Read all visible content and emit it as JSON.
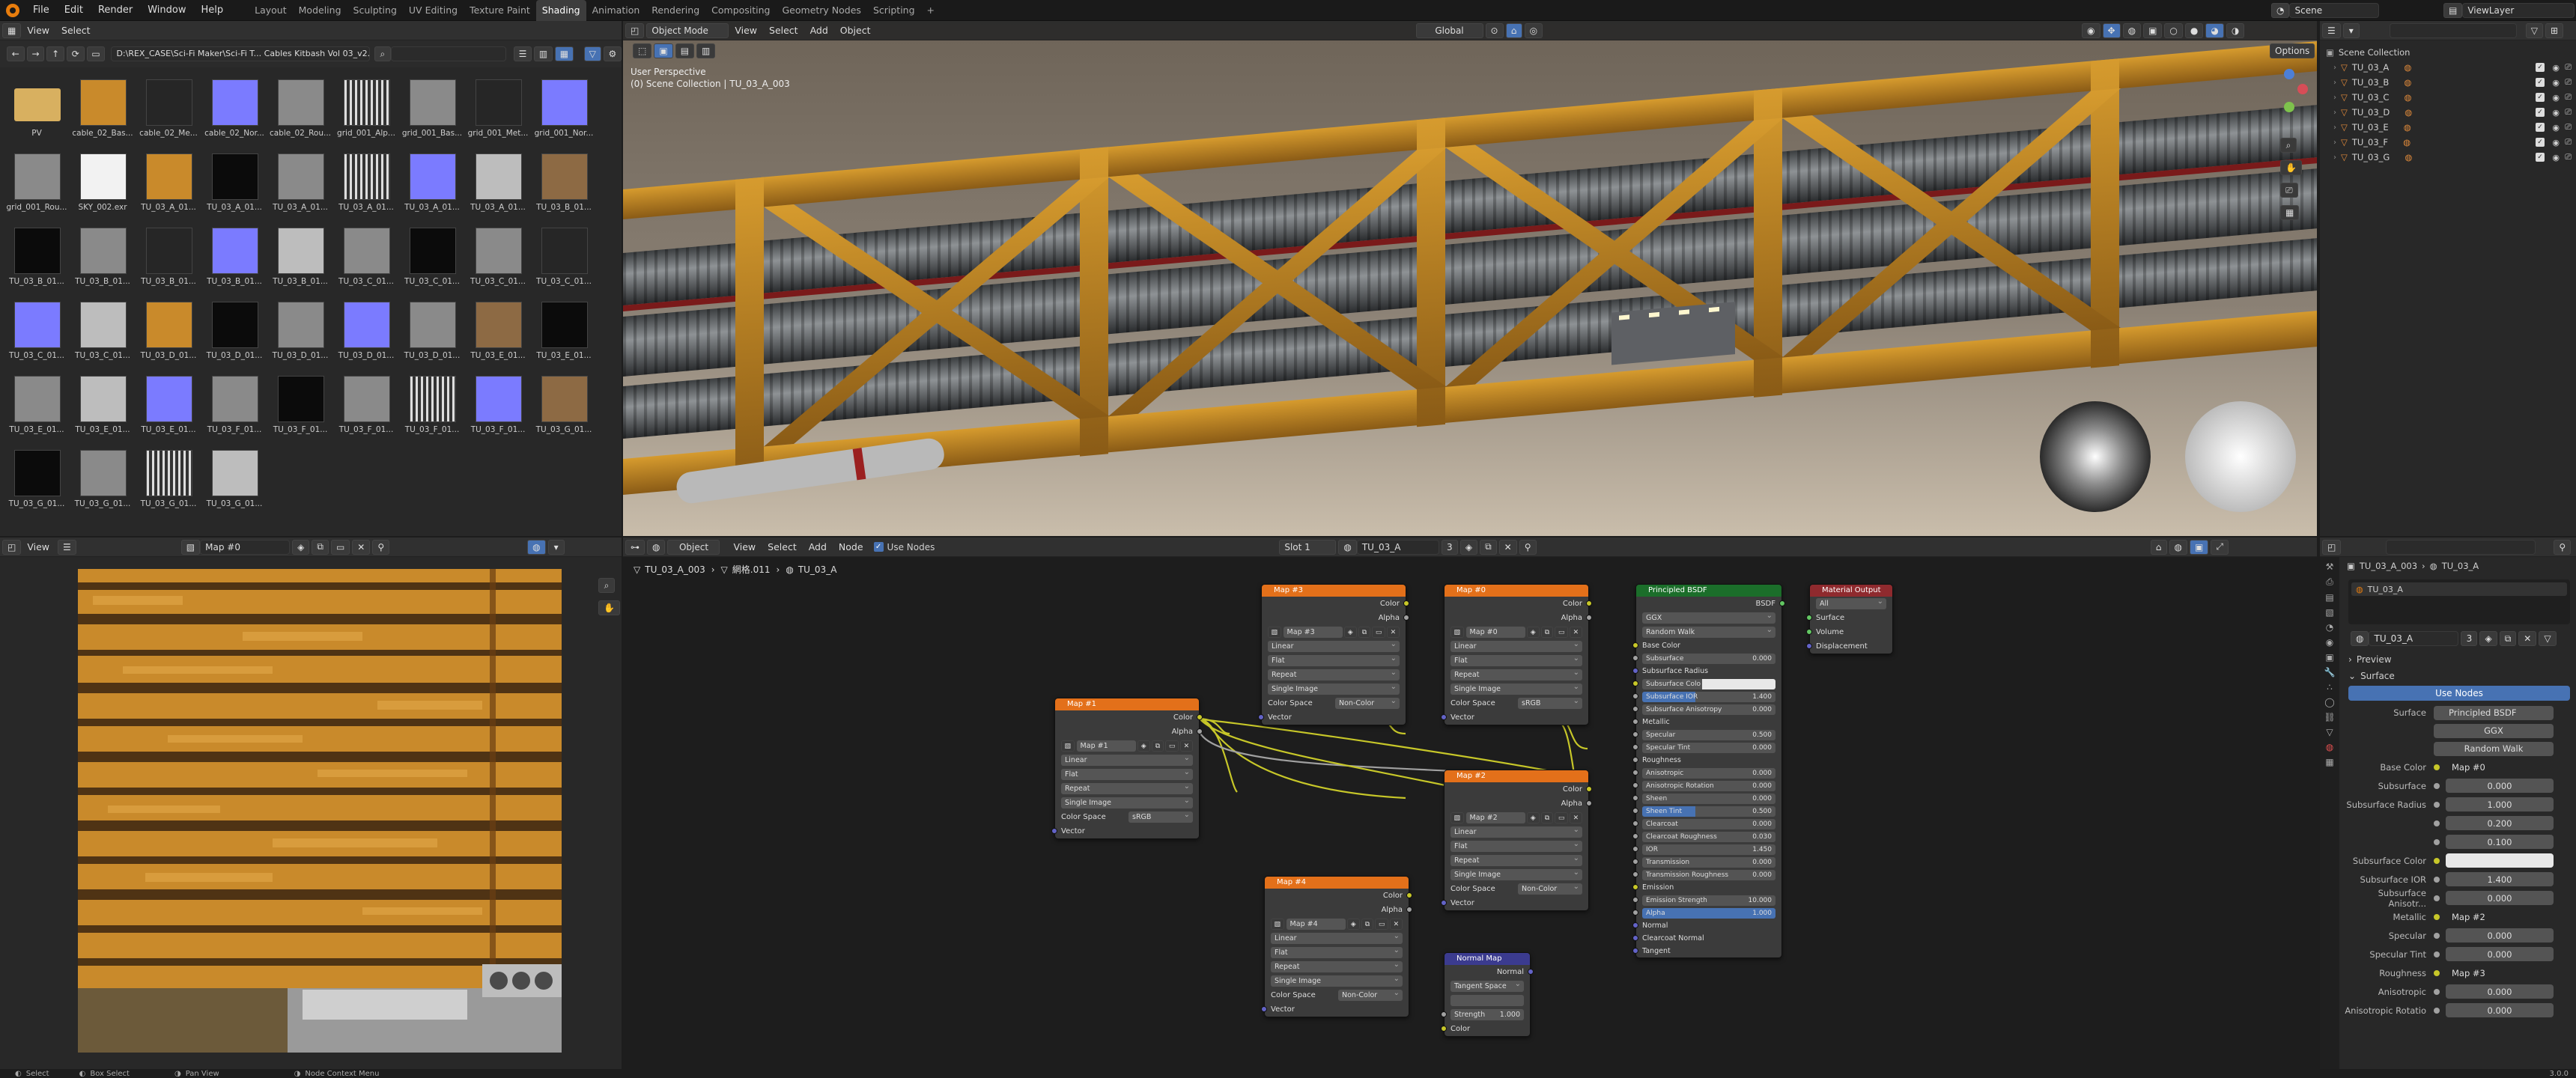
{
  "topbar": {
    "menus": [
      "File",
      "Edit",
      "Render",
      "Window",
      "Help"
    ],
    "workspaces": [
      "Layout",
      "Modeling",
      "Sculpting",
      "UV Editing",
      "Texture Paint",
      "Shading",
      "Animation",
      "Rendering",
      "Compositing",
      "Geometry Nodes",
      "Scripting"
    ],
    "active_workspace": "Shading",
    "add_tab": "+",
    "scene": "Scene",
    "view_layer": "ViewLayer"
  },
  "file_browser": {
    "view_menu": "View",
    "select_menu": "Select",
    "path": "D:\\REX_CASE\\Sci-Fi Maker\\Sci-Fi T... Cables Kitbash Vol 03_v2.0_PBR\\",
    "thumbnails": [
      {
        "label": "PV",
        "kind": "folder"
      },
      {
        "label": "cable_02_Bas...",
        "kind": "rust"
      },
      {
        "label": "cable_02_Me...",
        "kind": "dark"
      },
      {
        "label": "cable_02_Nor...",
        "kind": "normal"
      },
      {
        "label": "cable_02_Rou...",
        "kind": "gray"
      },
      {
        "label": "grid_001_Alp...",
        "kind": "stripes"
      },
      {
        "label": "grid_001_Bas...",
        "kind": "gray"
      },
      {
        "label": "grid_001_Met...",
        "kind": "dark"
      },
      {
        "label": "grid_001_Nor...",
        "kind": "normal"
      },
      {
        "label": "grid_001_Rou...",
        "kind": "gray"
      },
      {
        "label": "SKY_002.exr",
        "kind": "white"
      },
      {
        "label": "TU_03_A_01...",
        "kind": "rust"
      },
      {
        "label": "TU_03_A_01...",
        "kind": "black"
      },
      {
        "label": "TU_03_A_01...",
        "kind": "gray"
      },
      {
        "label": "TU_03_A_01...",
        "kind": "stripes"
      },
      {
        "label": "TU_03_A_01...",
        "kind": "normal"
      },
      {
        "label": "TU_03_A_01...",
        "kind": "light"
      },
      {
        "label": "TU_03_B_01...",
        "kind": "rustgray"
      },
      {
        "label": "TU_03_B_01...",
        "kind": "black"
      },
      {
        "label": "TU_03_B_01...",
        "kind": "gray"
      },
      {
        "label": "TU_03_B_01...",
        "kind": "dark"
      },
      {
        "label": "TU_03_B_01...",
        "kind": "normal"
      },
      {
        "label": "TU_03_B_01...",
        "kind": "light"
      },
      {
        "label": "TU_03_C_01...",
        "kind": "gray"
      },
      {
        "label": "TU_03_C_01...",
        "kind": "black"
      },
      {
        "label": "TU_03_C_01...",
        "kind": "gray"
      },
      {
        "label": "TU_03_C_01...",
        "kind": "dark"
      },
      {
        "label": "TU_03_C_01...",
        "kind": "normal"
      },
      {
        "label": "TU_03_C_01...",
        "kind": "light"
      },
      {
        "label": "TU_03_D_01...",
        "kind": "rust"
      },
      {
        "label": "TU_03_D_01...",
        "kind": "black"
      },
      {
        "label": "TU_03_D_01...",
        "kind": "gray"
      },
      {
        "label": "TU_03_D_01...",
        "kind": "normal"
      },
      {
        "label": "TU_03_D_01...",
        "kind": "gray"
      },
      {
        "label": "TU_03_E_01...",
        "kind": "rustgray"
      },
      {
        "label": "TU_03_E_01...",
        "kind": "black"
      },
      {
        "label": "TU_03_E_01...",
        "kind": "gray"
      },
      {
        "label": "TU_03_E_01...",
        "kind": "light"
      },
      {
        "label": "TU_03_E_01...",
        "kind": "normal"
      },
      {
        "label": "TU_03_F_01...",
        "kind": "gray"
      },
      {
        "label": "TU_03_F_01...",
        "kind": "black"
      },
      {
        "label": "TU_03_F_01...",
        "kind": "gray"
      },
      {
        "label": "TU_03_F_01...",
        "kind": "stripes"
      },
      {
        "label": "TU_03_F_01...",
        "kind": "normal"
      },
      {
        "label": "TU_03_G_01...",
        "kind": "rustgray"
      },
      {
        "label": "TU_03_G_01...",
        "kind": "black"
      },
      {
        "label": "TU_03_G_01...",
        "kind": "gray"
      },
      {
        "label": "TU_03_G_01...",
        "kind": "stripes"
      },
      {
        "label": "TU_03_G_01...",
        "kind": "light"
      }
    ]
  },
  "viewport": {
    "mode": "Object Mode",
    "menus": [
      "View",
      "Select",
      "Add",
      "Object"
    ],
    "orientation": "Global",
    "options": "Options",
    "perspective": "User Perspective",
    "collection_info": "(0) Scene Collection | TU_03_A_003"
  },
  "outliner": {
    "title": "Scene Collection",
    "items": [
      "TU_03_A",
      "TU_03_B",
      "TU_03_C",
      "TU_03_D",
      "TU_03_E",
      "TU_03_F",
      "TU_03_G"
    ]
  },
  "image_editor": {
    "view_menu": "View",
    "image_name": "Map #0"
  },
  "node_editor": {
    "object_label": "Object",
    "menus": [
      "View",
      "Select",
      "Add",
      "Node"
    ],
    "use_nodes": "Use Nodes",
    "slot": "Slot 1",
    "material": "TU_03_A",
    "users": "3",
    "breadcrumb": [
      "TU_03_A_003",
      "網格.011",
      "TU_03_A"
    ],
    "maps": [
      {
        "title": "Map #3",
        "image": "Map #3",
        "interp": "Linear",
        "proj": "Flat",
        "ext": "Repeat",
        "src": "Single Image",
        "cs_label": "Color Space",
        "cs": "Non-Color",
        "out1": "Color",
        "out2": "Alpha",
        "in": "Vector"
      },
      {
        "title": "Map #0",
        "image": "Map #0",
        "interp": "Linear",
        "proj": "Flat",
        "ext": "Repeat",
        "src": "Single Image",
        "cs_label": "Color Space",
        "cs": "sRGB",
        "out1": "Color",
        "out2": "Alpha",
        "in": "Vector"
      },
      {
        "title": "Map #1",
        "image": "Map #1",
        "interp": "Linear",
        "proj": "Flat",
        "ext": "Repeat",
        "src": "Single Image",
        "cs_label": "Color Space",
        "cs": "sRGB",
        "out1": "Color",
        "out2": "Alpha",
        "in": "Vector"
      },
      {
        "title": "Map #2",
        "image": "Map #2",
        "interp": "Linear",
        "proj": "Flat",
        "ext": "Repeat",
        "src": "Single Image",
        "cs_label": "Color Space",
        "cs": "Non-Color",
        "out1": "Color",
        "out2": "Alpha",
        "in": "Vector"
      },
      {
        "title": "Map #4",
        "image": "Map #4",
        "interp": "Linear",
        "proj": "Flat",
        "ext": "Repeat",
        "src": "Single Image",
        "cs_label": "Color Space",
        "cs": "Non-Color",
        "out1": "Color",
        "out2": "Alpha",
        "in": "Vector"
      }
    ],
    "normal_map": {
      "title": "Normal Map",
      "out": "Normal",
      "space": "Tangent Space",
      "strength_label": "Strength",
      "strength": "1.000",
      "in": "Color"
    },
    "bsdf": {
      "title": "Principled BSDF",
      "out": "BSDF",
      "dist": "GGX",
      "sss": "Random Walk",
      "base_color": "Base Color",
      "params": [
        {
          "name": "Subsurface",
          "value": "0.000"
        },
        {
          "name": "Subsurface Radius",
          "value": ""
        },
        {
          "name": "Subsurface Colo",
          "value": ""
        },
        {
          "name": "Subsurface IOR",
          "value": "1.400"
        },
        {
          "name": "Subsurface Anisotropy",
          "value": "0.000"
        },
        {
          "name": "Metallic",
          "value": ""
        },
        {
          "name": "Specular",
          "value": "0.500"
        },
        {
          "name": "Specular Tint",
          "value": "0.000"
        },
        {
          "name": "Roughness",
          "value": ""
        },
        {
          "name": "Anisotropic",
          "value": "0.000"
        },
        {
          "name": "Anisotropic Rotation",
          "value": "0.000"
        },
        {
          "name": "Sheen",
          "value": "0.000"
        },
        {
          "name": "Sheen Tint",
          "value": "0.500"
        },
        {
          "name": "Clearcoat",
          "value": "0.000"
        },
        {
          "name": "Clearcoat Roughness",
          "value": "0.030"
        },
        {
          "name": "IOR",
          "value": "1.450"
        },
        {
          "name": "Transmission",
          "value": "0.000"
        },
        {
          "name": "Transmission Roughness",
          "value": "0.000"
        },
        {
          "name": "Emission",
          "value": ""
        },
        {
          "name": "Emission Strength",
          "value": "10.000"
        },
        {
          "name": "Alpha",
          "value": "1.000"
        },
        {
          "name": "Normal",
          "value": ""
        },
        {
          "name": "Clearcoat Normal",
          "value": ""
        },
        {
          "name": "Tangent",
          "value": ""
        }
      ]
    },
    "output": {
      "title": "Material Output",
      "target": "All",
      "inputs": [
        "Surface",
        "Volume",
        "Displacement"
      ]
    }
  },
  "properties": {
    "object": "TU_03_A_003",
    "material_link": "TU_03_A",
    "slot": "TU_03_A",
    "material_name": "TU_03_A",
    "users": "3",
    "preview": "Preview",
    "surface": "Surface",
    "use_nodes": "Use Nodes",
    "surface_label": "Surface",
    "surface_value": "Principled BSDF",
    "dist": "GGX",
    "sss": "Random Walk",
    "fields": [
      {
        "label": "Base Color",
        "value": "Map #0",
        "kind": "link"
      },
      {
        "label": "Subsurface",
        "value": "0.000",
        "kind": "num"
      },
      {
        "label": "Subsurface Radius",
        "value": "1.000",
        "kind": "num"
      },
      {
        "label": "",
        "value": "0.200",
        "kind": "num"
      },
      {
        "label": "",
        "value": "0.100",
        "kind": "num"
      },
      {
        "label": "Subsurface Color",
        "value": "",
        "kind": "color"
      },
      {
        "label": "Subsurface IOR",
        "value": "1.400",
        "kind": "num"
      },
      {
        "label": "Subsurface Anisotr...",
        "value": "0.000",
        "kind": "num"
      },
      {
        "label": "Metallic",
        "value": "Map #2",
        "kind": "link"
      },
      {
        "label": "Specular",
        "value": "0.000",
        "kind": "num"
      },
      {
        "label": "Specular Tint",
        "value": "0.000",
        "kind": "num"
      },
      {
        "label": "Roughness",
        "value": "Map #3",
        "kind": "link"
      },
      {
        "label": "Anisotropic",
        "value": "0.000",
        "kind": "num"
      },
      {
        "label": "Anisotropic Rotatio",
        "value": "0.000",
        "kind": "num"
      }
    ],
    "version": "3.0.0"
  },
  "statusbar": {
    "items": [
      "Select",
      "Box Select",
      "Pan View",
      "Node Context Menu"
    ]
  },
  "colors": {
    "accent": "#4772b3",
    "header_tex": "#e3701a",
    "bsdf_header": "#1b6e2a",
    "output_header": "#8f2a2e",
    "normal_header": "#3b3b8f",
    "rust": "#c98a2b"
  }
}
